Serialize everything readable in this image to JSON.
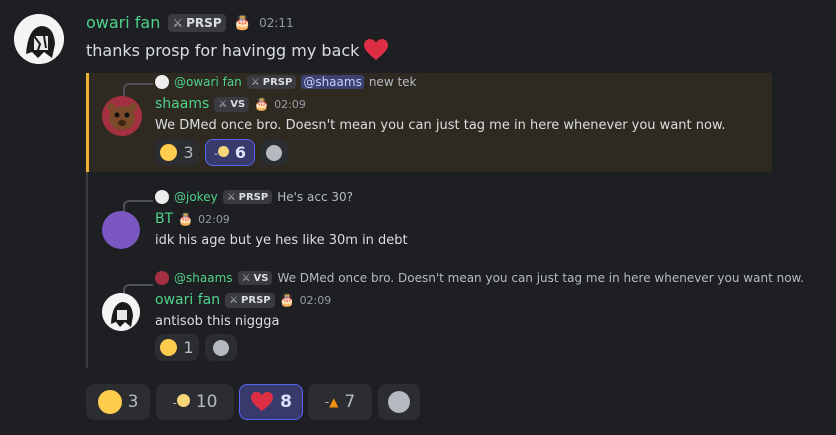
{
  "main_message": {
    "author": "owari fan",
    "tag": "PRSP",
    "time": "02:11",
    "text": "thanks prosp for havingg my back"
  },
  "quote1": {
    "reply_author": "@owari fan",
    "reply_tag": "PRSP",
    "reply_mention": "@shaams",
    "reply_text": "new tek",
    "author": "shaams",
    "tag": "VS",
    "time": "02:09",
    "text": "We DMed once bro. Doesn't mean you can just tag me in here whenever you want now.",
    "reactions": [
      {
        "emoji": "sob",
        "count": "3"
      },
      {
        "emoji": "cold-face",
        "prefix": "-",
        "count": "6"
      }
    ]
  },
  "quote2": {
    "reply_author": "@jokey",
    "reply_tag": "PRSP",
    "reply_text": "He's acc 30?",
    "author": "BT",
    "time": "02:09",
    "text": "idk his age but ye hes like 30m in debt",
    "avatar_color": "#7b57c2"
  },
  "quote3": {
    "reply_author": "@shaams",
    "reply_tag": "VS",
    "reply_text": "We DMed once bro. Doesn't mean you can just tag me in here whenever you want now.",
    "author": "owari fan",
    "tag": "PRSP",
    "time": "02:09",
    "text": "antisob this niggga",
    "reactions": [
      {
        "emoji": "sob",
        "count": "1"
      }
    ]
  },
  "reactions": [
    {
      "emoji": "sob",
      "count": "3"
    },
    {
      "emoji": "cold-face",
      "prefix": "-",
      "count": "10"
    },
    {
      "emoji": "heart",
      "count": "8"
    },
    {
      "emoji": "fire",
      "prefix": "-",
      "count": "7"
    }
  ],
  "colors": {
    "background": "#1e1f22",
    "highlight_bg": "#2e2a21",
    "highlight_border": "#f0b232",
    "name_green": "#4fd18b",
    "accent": "#5865f2"
  }
}
